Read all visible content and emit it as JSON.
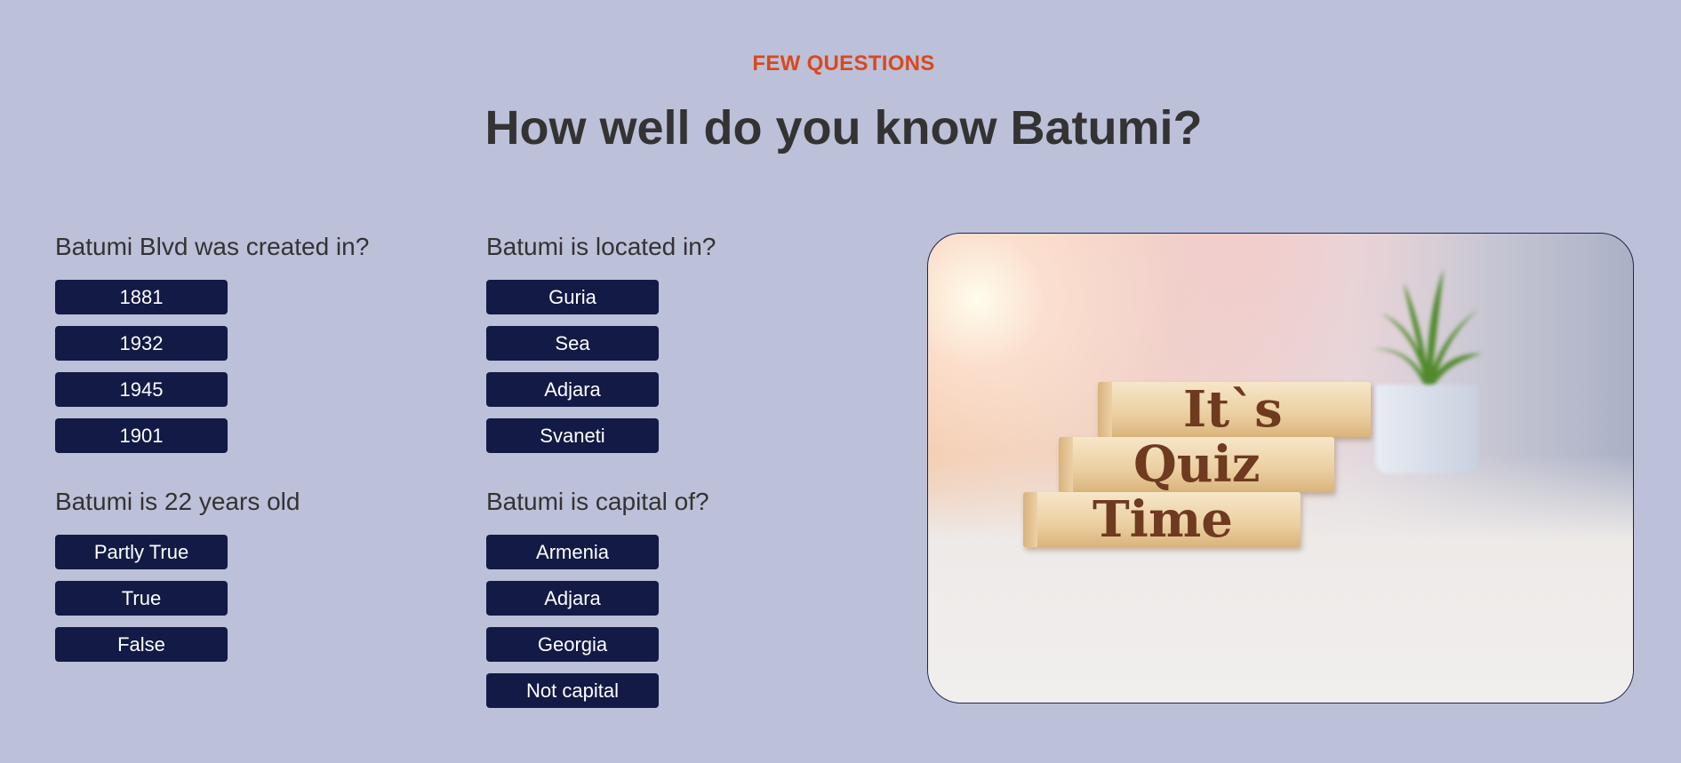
{
  "eyebrow": "FEW QUESTIONS",
  "heading": "How well do you know Batumi?",
  "colors": {
    "background": "#bcc0d8",
    "accent": "#d9481e",
    "button": "#121a45",
    "text": "#333333"
  },
  "questions": [
    {
      "title": "Batumi Blvd was created in?",
      "options": [
        "1881",
        "1932",
        "1945",
        "1901"
      ]
    },
    {
      "title": "Batumi is located in?",
      "options": [
        "Guria",
        "Sea",
        "Adjara",
        "Svaneti"
      ]
    },
    {
      "title": "Batumi is 22 years old",
      "options": [
        "Partly True",
        "True",
        "False"
      ]
    },
    {
      "title": "Batumi is capital of?",
      "options": [
        "Armenia",
        "Adjara",
        "Georgia",
        "Not capital"
      ]
    }
  ],
  "image": {
    "blocks": [
      "It`s",
      "Quiz",
      "Time"
    ]
  }
}
